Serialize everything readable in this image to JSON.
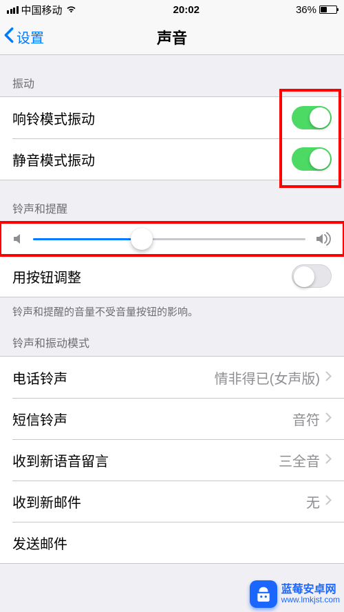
{
  "status": {
    "carrier": "中国移动",
    "time": "20:02",
    "battery_pct": "36%"
  },
  "nav": {
    "back_label": "设置",
    "title": "声音"
  },
  "sections": {
    "vibration_header": "振动",
    "ringtone_reminder_header": "铃声和提醒",
    "ringtone_pattern_header": "铃声和振动模式"
  },
  "cells": {
    "ring_vibrate": {
      "label": "响铃模式振动",
      "on": true
    },
    "silent_vibrate": {
      "label": "静音模式振动",
      "on": true
    },
    "volume_slider": {
      "value_pct": 40
    },
    "button_adjust": {
      "label": "用按钮调整",
      "on": false
    },
    "button_adjust_footer": "铃声和提醒的音量不受音量按钮的影响。",
    "ringtone": {
      "label": "电话铃声",
      "value": "情非得已(女声版)"
    },
    "text_tone": {
      "label": "短信铃声",
      "value": "音符"
    },
    "new_voicemail": {
      "label": "收到新语音留言",
      "value": "三全音"
    },
    "new_mail": {
      "label": "收到新邮件",
      "value": "无"
    },
    "send_mail": {
      "label": "发送邮件"
    }
  },
  "watermark": {
    "name": "蓝莓安卓网",
    "url": "www.lmkjst.com"
  }
}
